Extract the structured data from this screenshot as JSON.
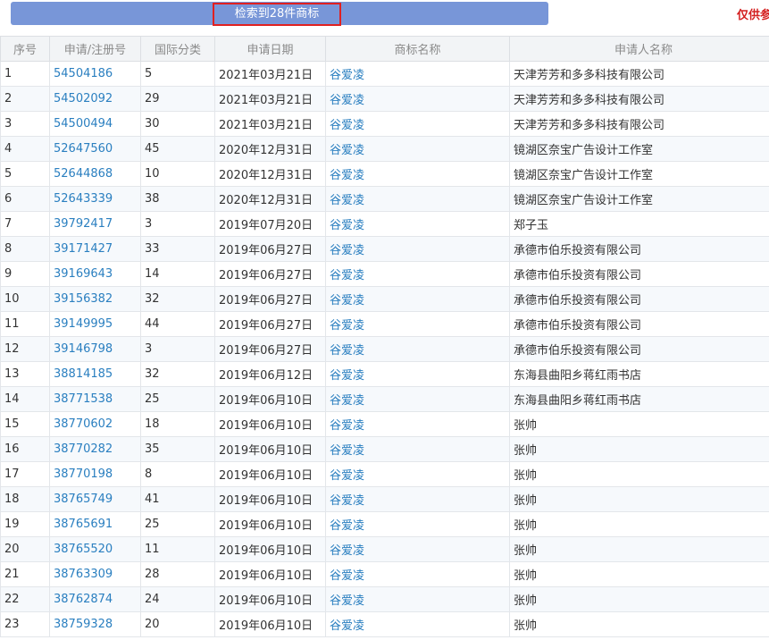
{
  "header": {
    "result_label": "检索到28件商标",
    "notice": "仅供参"
  },
  "table": {
    "columns": [
      "序号",
      "申请/注册号",
      "国际分类",
      "申请日期",
      "商标名称",
      "申请人名称"
    ],
    "rows": [
      {
        "seq": "1",
        "reg_no": "54504186",
        "class": "5",
        "date": "2021年03月21日",
        "mark": "谷爱凌",
        "applicant": "天津芳芳和多多科技有限公司"
      },
      {
        "seq": "2",
        "reg_no": "54502092",
        "class": "29",
        "date": "2021年03月21日",
        "mark": "谷爱凌",
        "applicant": "天津芳芳和多多科技有限公司"
      },
      {
        "seq": "3",
        "reg_no": "54500494",
        "class": "30",
        "date": "2021年03月21日",
        "mark": "谷爱凌",
        "applicant": "天津芳芳和多多科技有限公司"
      },
      {
        "seq": "4",
        "reg_no": "52647560",
        "class": "45",
        "date": "2020年12月31日",
        "mark": "谷爱凌",
        "applicant": "镜湖区奈宝广告设计工作室"
      },
      {
        "seq": "5",
        "reg_no": "52644868",
        "class": "10",
        "date": "2020年12月31日",
        "mark": "谷爱凌",
        "applicant": "镜湖区奈宝广告设计工作室"
      },
      {
        "seq": "6",
        "reg_no": "52643339",
        "class": "38",
        "date": "2020年12月31日",
        "mark": "谷爱凌",
        "applicant": "镜湖区奈宝广告设计工作室"
      },
      {
        "seq": "7",
        "reg_no": "39792417",
        "class": "3",
        "date": "2019年07月20日",
        "mark": "谷爱凌",
        "applicant": "郑子玉"
      },
      {
        "seq": "8",
        "reg_no": "39171427",
        "class": "33",
        "date": "2019年06月27日",
        "mark": "谷爱凌",
        "applicant": "承德市伯乐投资有限公司"
      },
      {
        "seq": "9",
        "reg_no": "39169643",
        "class": "14",
        "date": "2019年06月27日",
        "mark": "谷爱凌",
        "applicant": "承德市伯乐投资有限公司"
      },
      {
        "seq": "10",
        "reg_no": "39156382",
        "class": "32",
        "date": "2019年06月27日",
        "mark": "谷爱凌",
        "applicant": "承德市伯乐投资有限公司"
      },
      {
        "seq": "11",
        "reg_no": "39149995",
        "class": "44",
        "date": "2019年06月27日",
        "mark": "谷爱凌",
        "applicant": "承德市伯乐投资有限公司"
      },
      {
        "seq": "12",
        "reg_no": "39146798",
        "class": "3",
        "date": "2019年06月27日",
        "mark": "谷爱凌",
        "applicant": "承德市伯乐投资有限公司"
      },
      {
        "seq": "13",
        "reg_no": "38814185",
        "class": "32",
        "date": "2019年06月12日",
        "mark": "谷爱凌",
        "applicant": "东海县曲阳乡蒋红雨书店"
      },
      {
        "seq": "14",
        "reg_no": "38771538",
        "class": "25",
        "date": "2019年06月10日",
        "mark": "谷爱凌",
        "applicant": "东海县曲阳乡蒋红雨书店"
      },
      {
        "seq": "15",
        "reg_no": "38770602",
        "class": "18",
        "date": "2019年06月10日",
        "mark": "谷爱凌",
        "applicant": "张帅"
      },
      {
        "seq": "16",
        "reg_no": "38770282",
        "class": "35",
        "date": "2019年06月10日",
        "mark": "谷爱凌",
        "applicant": "张帅"
      },
      {
        "seq": "17",
        "reg_no": "38770198",
        "class": "8",
        "date": "2019年06月10日",
        "mark": "谷爱凌",
        "applicant": "张帅"
      },
      {
        "seq": "18",
        "reg_no": "38765749",
        "class": "41",
        "date": "2019年06月10日",
        "mark": "谷爱凌",
        "applicant": "张帅"
      },
      {
        "seq": "19",
        "reg_no": "38765691",
        "class": "25",
        "date": "2019年06月10日",
        "mark": "谷爱凌",
        "applicant": "张帅"
      },
      {
        "seq": "20",
        "reg_no": "38765520",
        "class": "11",
        "date": "2019年06月10日",
        "mark": "谷爱凌",
        "applicant": "张帅"
      },
      {
        "seq": "21",
        "reg_no": "38763309",
        "class": "28",
        "date": "2019年06月10日",
        "mark": "谷爱凌",
        "applicant": "张帅"
      },
      {
        "seq": "22",
        "reg_no": "38762874",
        "class": "24",
        "date": "2019年06月10日",
        "mark": "谷爱凌",
        "applicant": "张帅"
      },
      {
        "seq": "23",
        "reg_no": "38759328",
        "class": "20",
        "date": "2019年06月10日",
        "mark": "谷爱凌",
        "applicant": "张帅"
      }
    ]
  },
  "colors": {
    "result_bar": "#7896d8",
    "highlight_border": "#e02020",
    "notice_text": "#d42020",
    "link": "#2a7fc0"
  }
}
